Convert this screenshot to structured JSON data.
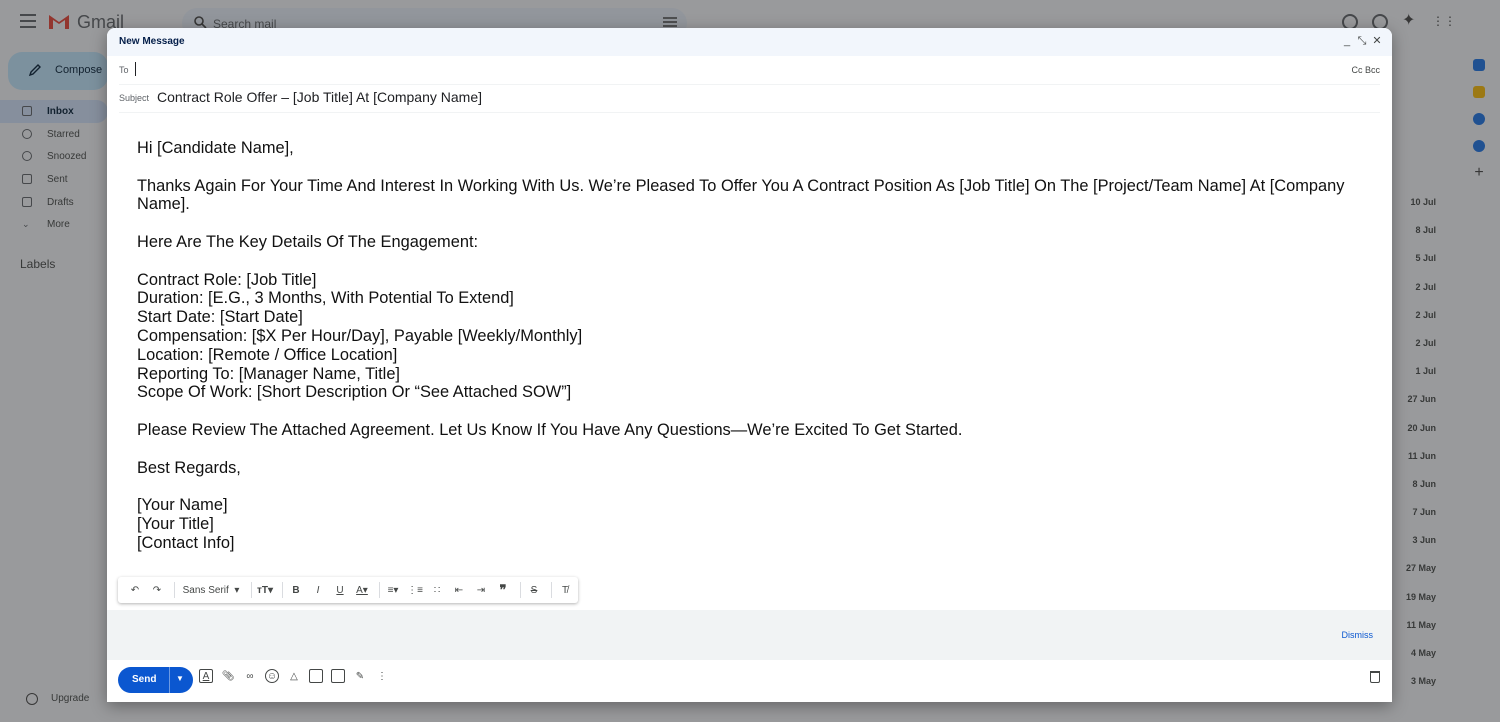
{
  "app": {
    "name": "Gmail"
  },
  "search": {
    "placeholder": "Search mail"
  },
  "compose_button": {
    "label": "Compose"
  },
  "sidebar": {
    "items": [
      {
        "label": "Inbox",
        "active": true
      },
      {
        "label": "Starred"
      },
      {
        "label": "Snoozed"
      },
      {
        "label": "Sent"
      },
      {
        "label": "Drafts"
      },
      {
        "label": "More"
      }
    ],
    "labels_heading": "Labels",
    "upgrade": "Upgrade"
  },
  "inbox_dates": [
    "10 Jul",
    "8 Jul",
    "5 Jul",
    "2 Jul",
    "2 Jul",
    "2 Jul",
    "1 Jul",
    "27 Jun",
    "20 Jun",
    "11 Jun",
    "8 Jun",
    "7 Jun",
    "3 Jun",
    "27 May",
    "19 May",
    "11 May",
    "4 May",
    "3 May"
  ],
  "compose": {
    "title": "New Message",
    "to_label": "To",
    "cc_bcc": "Cc Bcc",
    "subject_label": "Subject",
    "subject": "Contract Role Offer – [Job Title] At [Company Name]",
    "body": {
      "greeting": "Hi [Candidate Name],",
      "intro": "Thanks Again For Your Time And Interest In Working With Us. We’re Pleased To Offer You A Contract Position As [Job Title] On The [Project/Team Name] At [Company Name].",
      "details_heading": "Here Are The Key Details Of The Engagement:",
      "details": [
        "Contract Role: [Job Title]",
        "Duration: [E.G., 3 Months, With Potential To Extend]",
        "Start Date: [Start Date]",
        "Compensation: [$X Per Hour/Day], Payable [Weekly/Monthly]",
        "Location: [Remote / Office Location]",
        "Reporting To: [Manager Name, Title]",
        "Scope Of Work: [Short Description Or “See Attached SOW”]"
      ],
      "closing_line": "Please Review The Attached Agreement. Let Us Know If You Have Any Questions—We’re Excited To Get Started.",
      "sign_off": "Best Regards,",
      "signature": [
        "[Your Name]",
        "[Your Title]",
        "[Contact Info]"
      ]
    },
    "toolbar": {
      "font": "Sans Serif"
    },
    "dismiss": "Dismiss",
    "send": "Send"
  },
  "colors": {
    "send": "#0b57d0",
    "compose_header": "#f2f6fc",
    "compose_button": "#c2e7ff"
  }
}
